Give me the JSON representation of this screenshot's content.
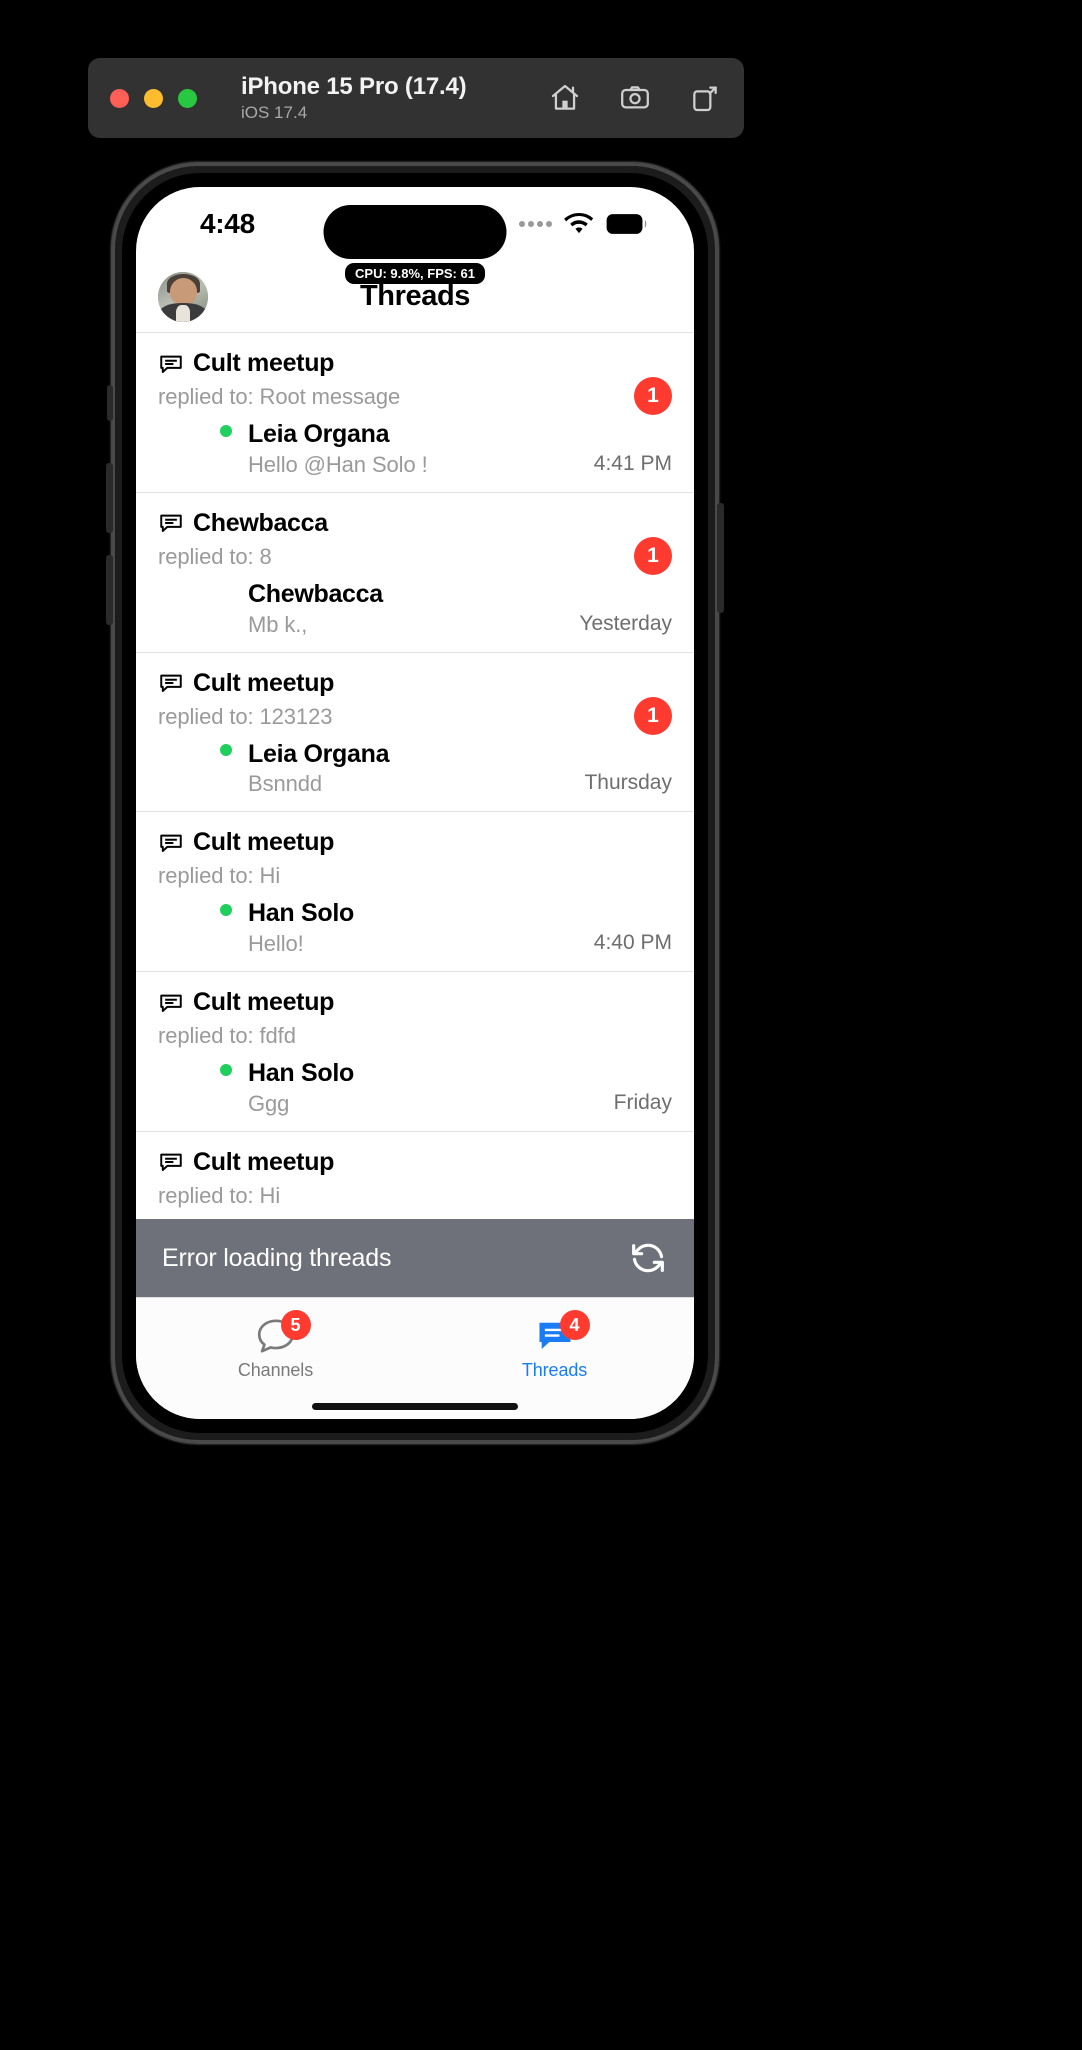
{
  "simulator": {
    "title": "iPhone 15 Pro (17.4)",
    "subtitle": "iOS 17.4",
    "window_controls": [
      "close",
      "minimize",
      "zoom"
    ],
    "toolbar": [
      {
        "name": "home-icon",
        "label": "Home"
      },
      {
        "name": "screenshot-icon",
        "label": "Screenshot"
      },
      {
        "name": "rotate-icon",
        "label": "Rotate"
      }
    ]
  },
  "status_bar": {
    "time": "4:48",
    "cellular": "signal-dots",
    "wifi": "wifi-icon",
    "battery": "battery-icon"
  },
  "perf_overlay": {
    "text": "CPU: 9.8%, FPS: 61"
  },
  "navbar": {
    "title": "Threads",
    "avatar_alt": "Han Solo"
  },
  "threads": [
    {
      "channel": "Cult meetup",
      "replied_to": "replied to: Root message",
      "unread": "1",
      "author": "Leia Organa",
      "preview": "Hello @Han Solo !",
      "time": "4:41 PM",
      "avatar": "leia",
      "online": true
    },
    {
      "channel": "Chewbacca",
      "replied_to": "replied to: 8",
      "unread": "1",
      "author": "Chewbacca",
      "preview": "Mb k.,",
      "time": "Yesterday",
      "avatar": "chew",
      "online": false
    },
    {
      "channel": "Cult meetup",
      "replied_to": "replied to: 123123",
      "unread": "1",
      "author": "Leia Organa",
      "preview": "Bsnndd",
      "time": "Thursday",
      "avatar": "leia",
      "online": true
    },
    {
      "channel": "Cult meetup",
      "replied_to": "replied to: Hi",
      "unread": "",
      "author": "Han Solo",
      "preview": "Hello!",
      "time": "4:40 PM",
      "avatar": "han",
      "online": true
    },
    {
      "channel": "Cult meetup",
      "replied_to": "replied to: fdfd",
      "unread": "",
      "author": "Han Solo",
      "preview": "Ggg",
      "time": "Friday",
      "avatar": "han",
      "online": true
    },
    {
      "channel": "Cult meetup",
      "replied_to": "replied to: Hi",
      "unread": "",
      "author": "",
      "preview": "",
      "time": "",
      "avatar": "han",
      "online": true
    }
  ],
  "error_banner": {
    "message": "Error loading threads",
    "refresh_icon": "refresh-icon",
    "background": "#6e7179"
  },
  "tab_bar": {
    "tabs": [
      {
        "label": "Channels",
        "badge": "5",
        "active": false,
        "icon": "chat-bubble-outline-icon"
      },
      {
        "label": "Threads",
        "badge": "4",
        "active": true,
        "icon": "chat-bubble-filled-icon"
      }
    ],
    "accent_color": "#1a7cf5",
    "badge_color": "#ff3b30"
  }
}
